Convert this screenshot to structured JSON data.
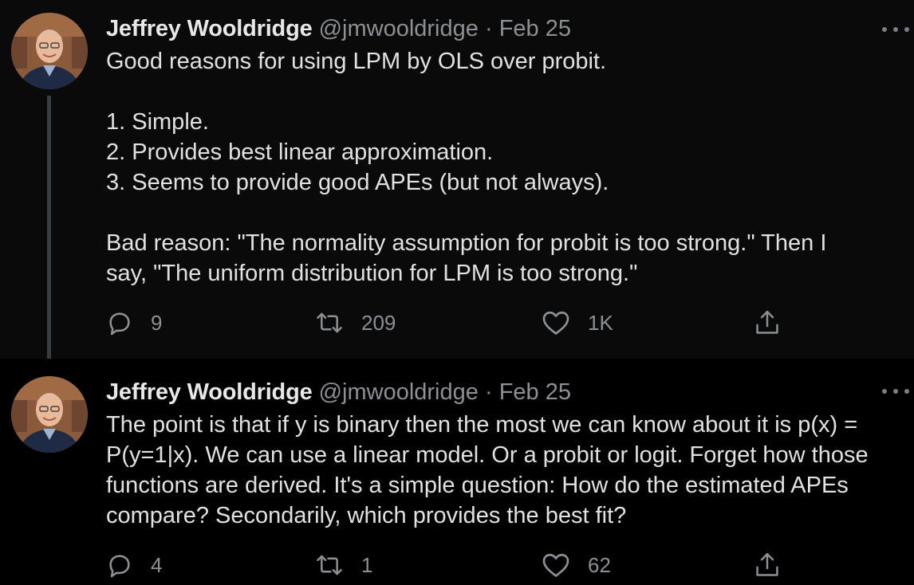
{
  "tweets": [
    {
      "author": {
        "name": "Jeffrey Wooldridge",
        "handle": "@jmwooldridge",
        "separator": "·",
        "date": "Feb 25"
      },
      "paragraphs": [
        [
          "Good reasons for using LPM by OLS over probit."
        ],
        [
          "1. Simple.",
          "2. Provides best linear approximation.",
          "3. Seems to provide good APEs (but not always)."
        ],
        [
          "Bad reason: \"The normality assumption for probit is too strong.\" Then I",
          "say, \"The uniform distribution for LPM is too strong.\""
        ]
      ],
      "stats": {
        "replies": "9",
        "retweets": "209",
        "likes": "1K"
      }
    },
    {
      "author": {
        "name": "Jeffrey Wooldridge",
        "handle": "@jmwooldridge",
        "separator": "·",
        "date": "Feb 25"
      },
      "paragraphs": [
        [
          "The point is that if y is binary then the most we can know about it is p(x) =",
          "P(y=1|x). We can use a linear model. Or a probit or logit. Forget how those",
          "functions are derived. It's a simple question: How do the estimated APEs",
          "compare? Secondarily, which provides the best fit?"
        ]
      ],
      "stats": {
        "replies": "4",
        "retweets": "1",
        "likes": "62"
      }
    }
  ],
  "icons": {
    "reply": "reply-icon",
    "retweet": "retweet-icon",
    "like": "heart-icon",
    "share": "share-icon",
    "more": "more-options-icon"
  },
  "colors": {
    "background": "#000000",
    "text": "#e1e1e1",
    "secondary": "#8b9095",
    "thread_line": "#3a3d40"
  }
}
